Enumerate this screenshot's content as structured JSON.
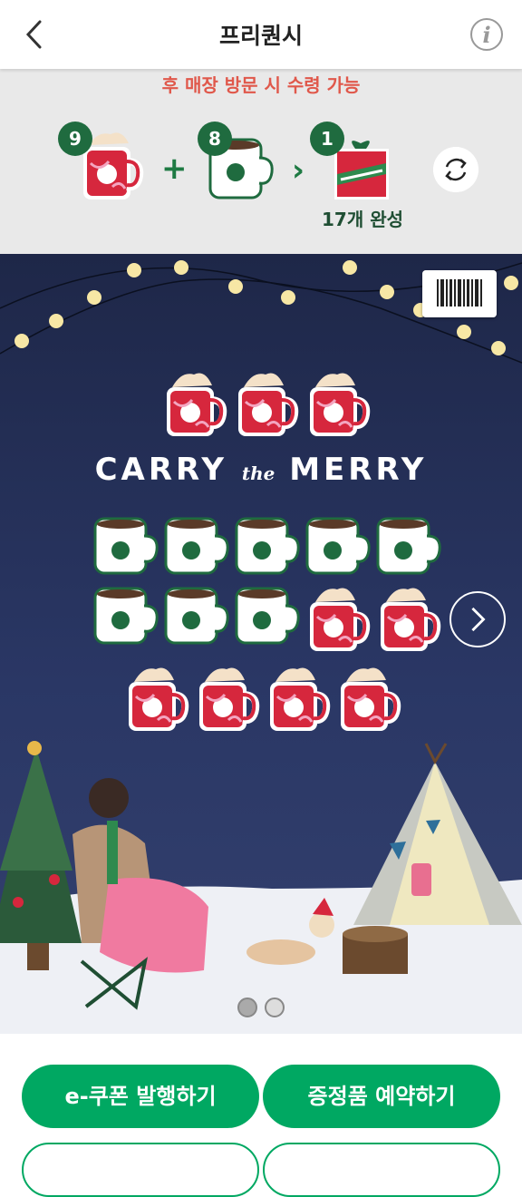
{
  "header": {
    "title": "프리퀀시"
  },
  "summary": {
    "notice": "후 매장 방문 시 수령 가능",
    "red_count": "9",
    "white_count": "8",
    "gift_count": "1",
    "complete_text": "17개 완성"
  },
  "card": {
    "title_left": "CARRY",
    "title_mid": "the",
    "title_right": "MERRY",
    "stickers": {
      "row1": [
        "red",
        "red",
        "red"
      ],
      "row2": [
        "white",
        "white",
        "white",
        "white",
        "white"
      ],
      "row3": [
        "white",
        "white",
        "white",
        "red",
        "red"
      ],
      "row4": [
        "red",
        "red",
        "red",
        "red"
      ]
    }
  },
  "buttons": {
    "coupon": "e-쿠폰 발행하기",
    "reserve": "증정품 예약하기"
  },
  "colors": {
    "accent_green": "#00a862",
    "dark_green": "#1f6b3f",
    "notice_red": "#e0584b"
  }
}
